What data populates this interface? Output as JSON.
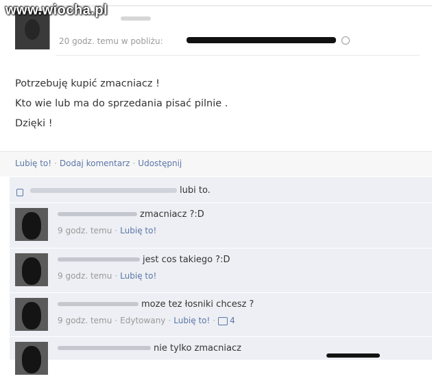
{
  "watermark": "www.wiocha.pl",
  "post": {
    "meta_time": "20 godz. temu w pobliżu:",
    "body_lines": [
      "Potrzebuję kupić zmacniacz !",
      "Kto wie lub ma do sprzedania pisać pilnie .",
      "Dzięki !"
    ]
  },
  "actions": {
    "like": "Lubię to!",
    "comment": "Dodaj komentarz",
    "share": "Udostępnij"
  },
  "likes": {
    "suffix": "lubi to."
  },
  "comments": [
    {
      "text": "zmacniacz ?:D",
      "time": "9 godz. temu",
      "like_label": "Lubię to!"
    },
    {
      "text": "jest cos takiego ?:D",
      "time": "9 godz. temu",
      "like_label": "Lubię to!"
    },
    {
      "text": "moze tez łosniki chcesz ?",
      "time": "9 godz. temu",
      "edited": "Edytowany",
      "like_label": "Lubię to!",
      "like_count": "4"
    },
    {
      "text": "nie tylko zmacniacz"
    }
  ]
}
